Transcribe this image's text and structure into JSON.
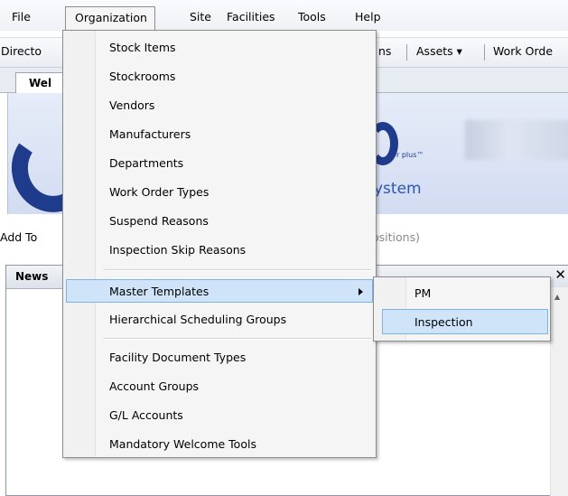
{
  "menubar": {
    "items": [
      {
        "label": "File"
      },
      {
        "label": "Organization"
      },
      {
        "label": "Site"
      },
      {
        "label": "Facilities"
      },
      {
        "label": "Tools"
      },
      {
        "label": "Help"
      }
    ]
  },
  "toolbar": {
    "directory_label": "Directo",
    "ns_label": "ns",
    "assets_label": "Assets ▾",
    "work_order_label": "Work Orde"
  },
  "tabs": {
    "welcome_label": "Wel"
  },
  "banner": {
    "rplus": "r plus™",
    "system_fragment": "ystem"
  },
  "add_row": {
    "add_label": "Add To",
    "positions_fragment": "ositions)"
  },
  "news_panel": {
    "title": "News",
    "close_glyph": "✕"
  },
  "organization_menu": {
    "items": [
      {
        "label": "Stock Items"
      },
      {
        "label": "Stockrooms"
      },
      {
        "label": "Vendors"
      },
      {
        "label": "Manufacturers"
      },
      {
        "label": "Departments"
      },
      {
        "label": "Work Order Types"
      },
      {
        "label": "Suspend Reasons"
      },
      {
        "label": "Inspection Skip Reasons"
      },
      {
        "label": "Master Templates"
      },
      {
        "label": "Hierarchical Scheduling Groups"
      },
      {
        "label": "Facility Document Types"
      },
      {
        "label": "Account Groups"
      },
      {
        "label": "G/L Accounts"
      },
      {
        "label": "Mandatory Welcome Tools"
      }
    ]
  },
  "master_templates_submenu": {
    "items": [
      {
        "label": "PM"
      },
      {
        "label": "Inspection"
      }
    ]
  },
  "colors": {
    "highlight": "#cfe4f9",
    "highlight_border": "#7fb3e6",
    "brand_blue": "#1f3b8c"
  }
}
